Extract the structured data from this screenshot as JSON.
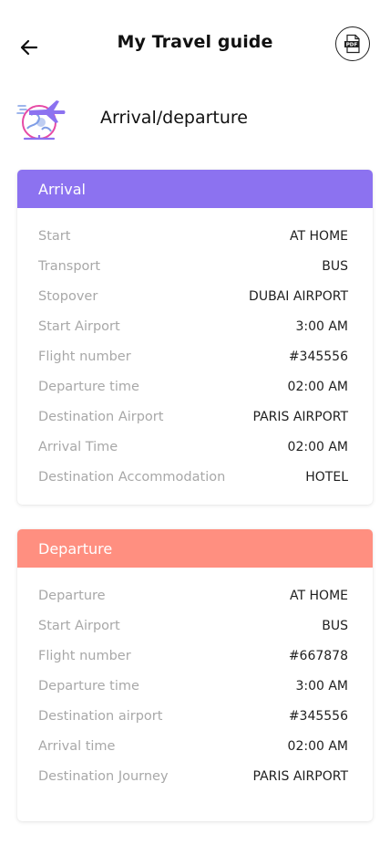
{
  "header": {
    "title": "My Travel guide",
    "back_icon": "arrow-left-icon",
    "pdf_icon": "pdf-icon",
    "pdf_text": "PDF"
  },
  "section": {
    "title": "Arrival/departure",
    "icon": "airplane-globe-icon",
    "colors": {
      "purple": "#8c72f0",
      "pink": "#e64aa5",
      "blue": "#7f9de6"
    }
  },
  "arrival": {
    "title": "Arrival",
    "color": "#8c72f0",
    "rows": [
      {
        "label": "Start",
        "value": "AT HOME"
      },
      {
        "label": "Transport",
        "value": "BUS"
      },
      {
        "label": "Stopover",
        "value": "DUBAI AIRPORT"
      },
      {
        "label": "Start Airport",
        "value": "3:00 AM"
      },
      {
        "label": "Flight number",
        "value": "#345556"
      },
      {
        "label": "Departure time",
        "value": "02:00 AM"
      },
      {
        "label": "Destination Airport",
        "value": "PARIS AIRPORT"
      },
      {
        "label": "Arrival Time",
        "value": "02:00 AM"
      },
      {
        "label": "Destination Accommodation",
        "value": "HOTEL"
      }
    ]
  },
  "departure": {
    "title": "Departure",
    "color": "#ff8f80",
    "rows": [
      {
        "label": "Departure",
        "value": "AT HOME"
      },
      {
        "label": "Start Airport",
        "value": "BUS"
      },
      {
        "label": "Flight number",
        "value": "#667878"
      },
      {
        "label": "Departure time",
        "value": "3:00 AM"
      },
      {
        "label": "Destination airport",
        "value": "#345556"
      },
      {
        "label": "Arrival time",
        "value": "02:00 AM"
      },
      {
        "label": "Destination Journey",
        "value": "PARIS AIRPORT"
      }
    ]
  }
}
